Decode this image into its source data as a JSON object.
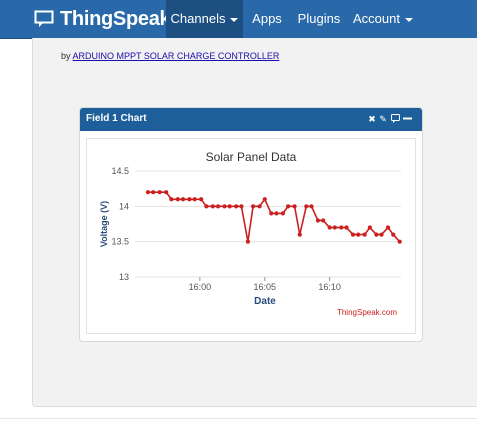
{
  "navbar": {
    "brand": "ThingSpeak",
    "items": [
      {
        "label": "Channels",
        "dropdown": true,
        "active": true
      },
      {
        "label": "Apps"
      },
      {
        "label": "Plugins"
      },
      {
        "label": "Account",
        "dropdown": true
      }
    ],
    "colors": {
      "bar": "#2a69a9",
      "active": "#1d4f82"
    }
  },
  "byline": {
    "prefix": "by",
    "link": "ARDUINO MPPT SOLAR CHARGE CONTROLLER"
  },
  "widget": {
    "title": "Field 1 Chart",
    "icons": [
      "close-icon",
      "edit-icon",
      "comment-icon",
      "minimize-icon"
    ],
    "credit": "ThingSpeak.com"
  },
  "chart_data": {
    "type": "line",
    "title": "Solar Panel Data",
    "xlabel": "Date",
    "ylabel": "Voltage (V)",
    "ylim": [
      13,
      14.5
    ],
    "yticks": [
      "14.5",
      "14",
      "13.5",
      "13"
    ],
    "xticks": [
      "16:00",
      "16:05",
      "16:10"
    ],
    "x": [
      "15:56.0",
      "15:56.4",
      "15:56.9",
      "15:57.4",
      "15:57.8",
      "15:58.3",
      "15:58.7",
      "15:59.2",
      "15:59.6",
      "16:00.1",
      "16:00.5",
      "16:01.0",
      "16:01.4",
      "16:01.9",
      "16:02.3",
      "16:02.8",
      "16:03.2",
      "16:03.7",
      "16:04.1",
      "16:04.6",
      "16:05.0",
      "16:05.5",
      "16:05.9",
      "16:06.4",
      "16:06.8",
      "16:07.3",
      "16:07.7",
      "16:08.2",
      "16:08.6",
      "16:09.1",
      "16:09.5",
      "16:10.0",
      "16:10.4",
      "16:10.9",
      "16:11.3",
      "16:11.8",
      "16:12.2",
      "16:12.7",
      "16:13.1",
      "16:13.6",
      "16:14.0",
      "16:14.5",
      "16:14.9",
      "16:15.4"
    ],
    "series": [
      {
        "color": "#cc1f1f",
        "values": [
          14.2,
          14.2,
          14.2,
          14.2,
          14.1,
          14.1,
          14.1,
          14.1,
          14.1,
          14.1,
          14.0,
          14.0,
          14.0,
          14.0,
          14.0,
          14.0,
          14.0,
          13.5,
          14.0,
          14.0,
          14.1,
          13.9,
          13.9,
          13.9,
          14.0,
          14.0,
          13.6,
          14.0,
          14.0,
          13.8,
          13.8,
          13.7,
          13.7,
          13.7,
          13.7,
          13.6,
          13.6,
          13.6,
          13.7,
          13.6,
          13.6,
          13.7,
          13.6,
          13.5
        ]
      }
    ],
    "grid": true,
    "legend": "none"
  }
}
